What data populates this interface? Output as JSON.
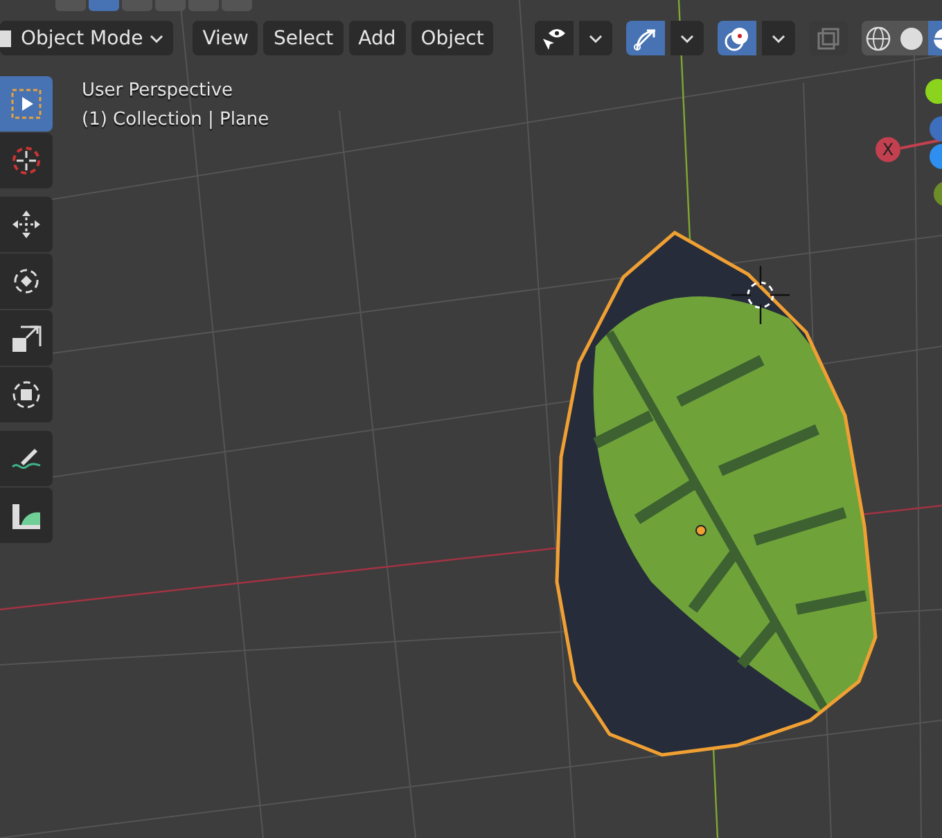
{
  "top_toolbar": {
    "buttons": [
      {
        "selected": false
      },
      {
        "selected": true
      },
      {
        "selected": false
      },
      {
        "selected": false
      },
      {
        "selected": false
      },
      {
        "selected": false
      }
    ]
  },
  "header": {
    "mode": "Object Mode",
    "menus": [
      "View",
      "Select",
      "Add",
      "Object"
    ],
    "toggles": [
      {
        "kind": "visibility",
        "selected": false
      },
      {
        "kind": "gizmo",
        "selected": true
      },
      {
        "kind": "overlay",
        "selected": true
      },
      {
        "kind": "xray",
        "selected": false
      }
    ],
    "shading": [
      {
        "kind": "wireframe",
        "selected": false
      },
      {
        "kind": "solid",
        "selected": false
      },
      {
        "kind": "material",
        "selected": true
      }
    ]
  },
  "viewport": {
    "view_name": "User Perspective",
    "object_info": "(1) Collection | Plane"
  },
  "tools": [
    {
      "kind": "select",
      "selected": true
    },
    {
      "kind": "cursor",
      "selected": false
    },
    {
      "kind": "move",
      "selected": false
    },
    {
      "kind": "rotate",
      "selected": false
    },
    {
      "kind": "scale",
      "selected": false
    },
    {
      "kind": "transform",
      "selected": false
    },
    {
      "kind": "annotate",
      "selected": false
    },
    {
      "kind": "measure",
      "selected": false
    }
  ],
  "navigation_gizmo": {
    "x_label": "X"
  }
}
